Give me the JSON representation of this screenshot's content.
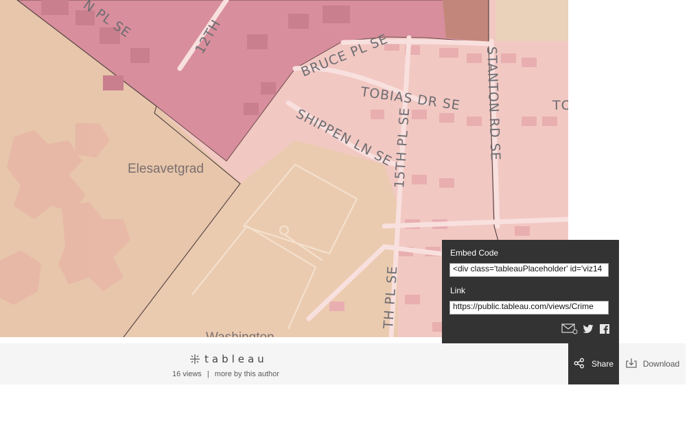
{
  "map": {
    "streets": {
      "n12th": "12TH",
      "bruce": "BRUCE PL SE",
      "tobias": "TOBIAS DR SE",
      "shippen": "SHIPPEN LN SE",
      "pl15th": "15TH PL SE",
      "stanton": "STANTON RD SE",
      "nplse": "N PL SE",
      "to": "TO",
      "thplse": "TH PL SE"
    },
    "places": {
      "elesavetgrad": "Elesavetgrad",
      "washington": "Washington"
    }
  },
  "toolbar": {
    "logo_text": "tableau",
    "views": "16 views",
    "separator": "|",
    "more_link": "more by this author",
    "share_label": "Share",
    "download_label": "Download"
  },
  "share_panel": {
    "embed_label": "Embed Code",
    "embed_value": "<div class='tableauPlaceholder' id='viz14",
    "link_label": "Link",
    "link_value": "https://public.tableau.com/views/Crime",
    "icons": [
      "email-icon",
      "twitter-icon",
      "facebook-icon"
    ]
  },
  "colors": {
    "panel": "#333333",
    "map_base": "#f2c8c3",
    "region_dark": "#d98f9d",
    "region_green": "#e6c0a6"
  }
}
